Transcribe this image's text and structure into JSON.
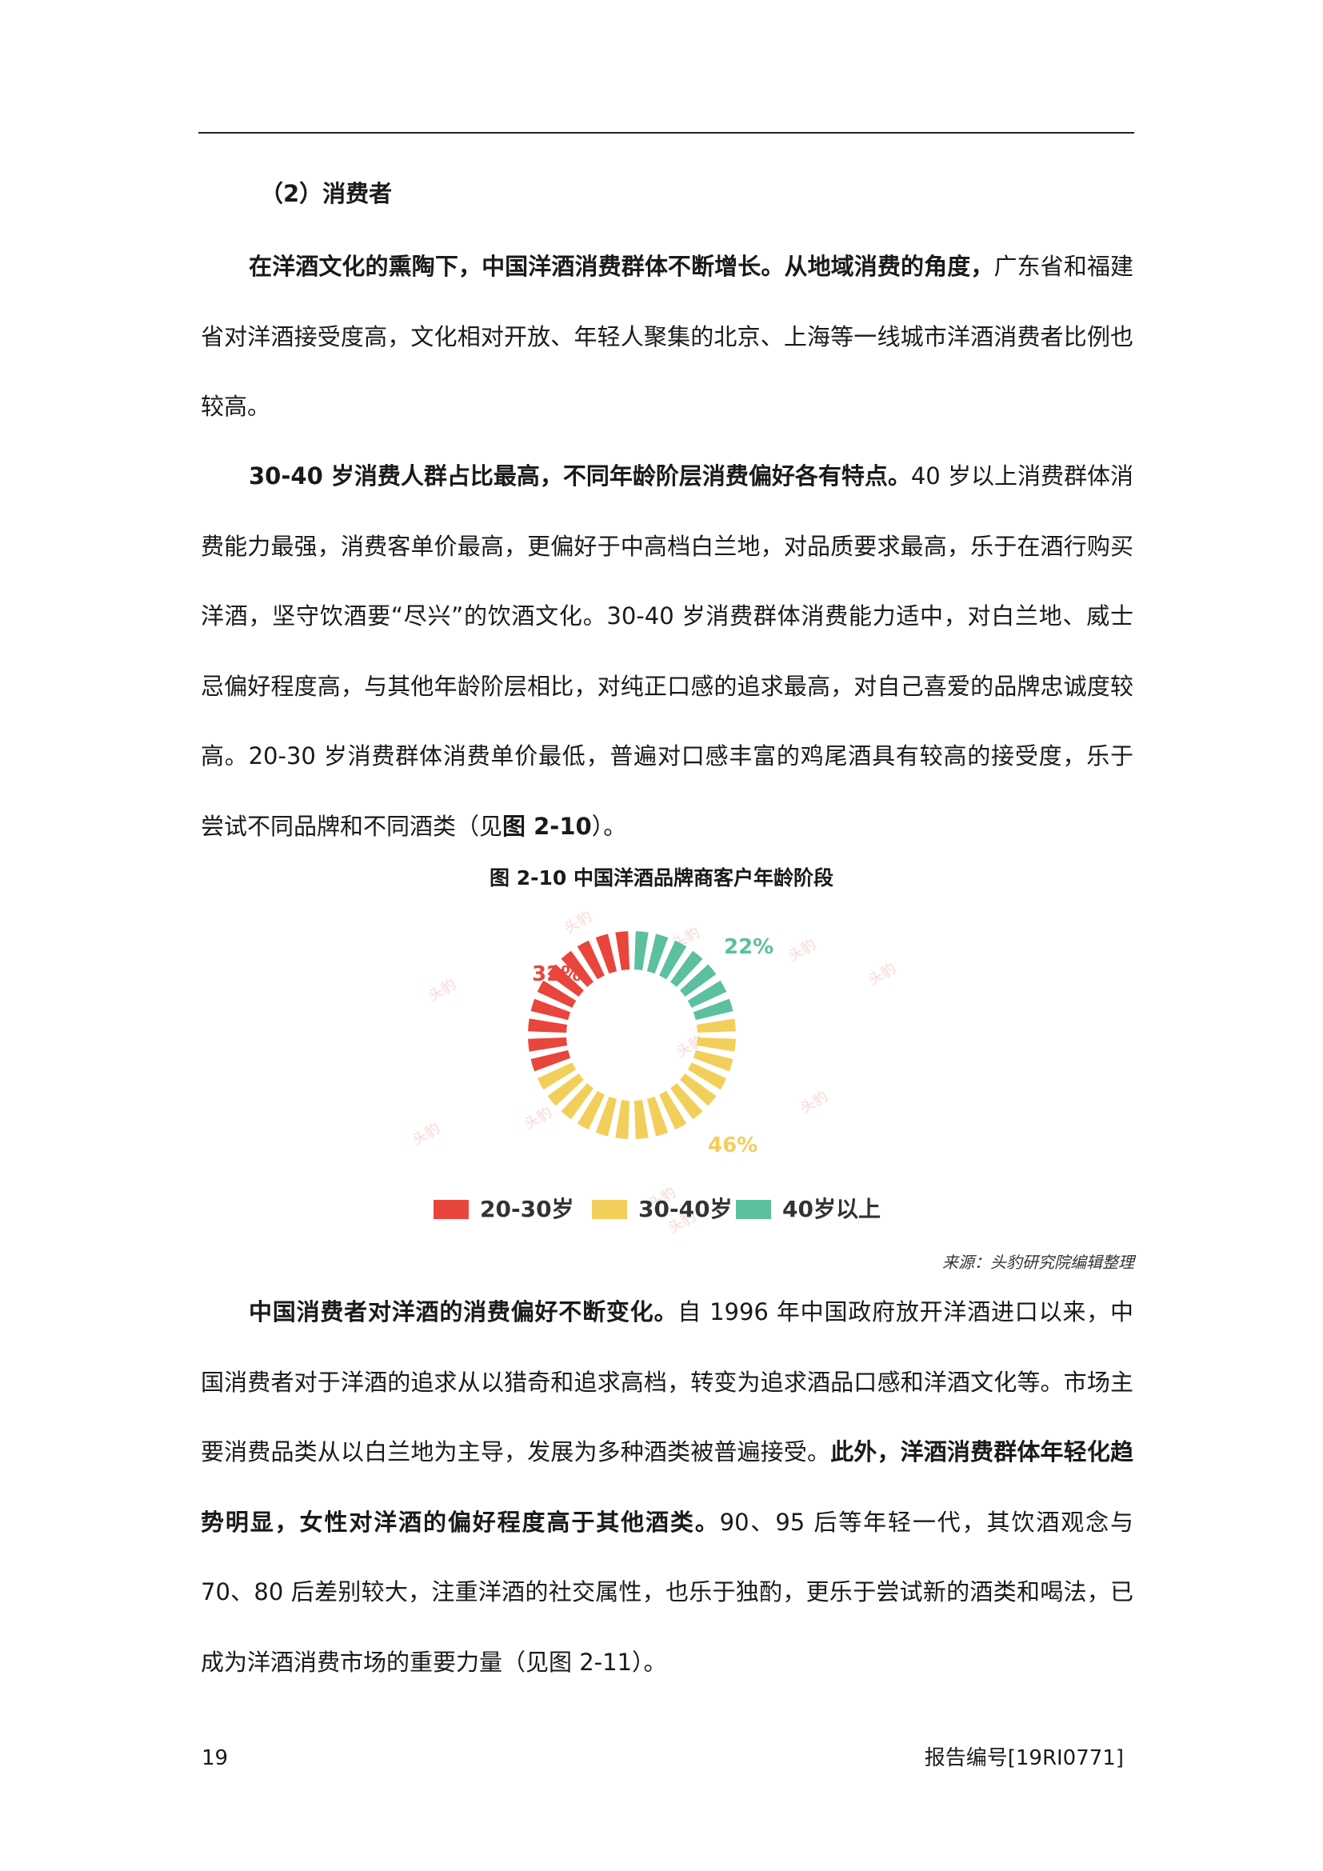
{
  "header": {},
  "section": {
    "heading": "（2）消费者"
  },
  "paragraphs": {
    "p1": [
      {
        "text": "在洋酒文化的熏陶下，中国洋酒消费群体不断增长。从地域消费的角度，",
        "bold": true
      },
      {
        "text": "广东省和福建省对洋酒接受度高，文化相对开放、年轻人聚集的北京、上海等一线城市洋酒消费者比例也较高。",
        "bold": false
      }
    ],
    "p2": [
      {
        "text": "30-40 岁消费人群占比最高，不同年龄阶层消费偏好各有特点。",
        "bold": true
      },
      {
        "text": "40 岁以上消费群体消费能力最强，消费客单价最高，更偏好于中高档白兰地，对品质要求最高，乐于在酒行购买洋酒，坚守饮酒要“尽兴”的饮酒文化。30-40 岁消费群体消费能力适中，对白兰地、威士忌偏好程度高，与其他年龄阶层相比，对纯正口感的追求最高，对自己喜爱的品牌忠诚度较高。20-30 岁消费群体消费单价最低，普遍对口感丰富的鸡尾酒具有较高的接受度，乐于尝试不同品牌和不同酒类（见",
        "bold": false
      },
      {
        "text": "图 2-10",
        "bold": true
      },
      {
        "text": "）。",
        "bold": false
      }
    ],
    "p3": [
      {
        "text": "中国消费者对洋酒的消费偏好不断变化。",
        "bold": true
      },
      {
        "text": "自 1996 年中国政府放开洋酒进口以来，中国消费者对于洋酒的追求从以猎奇和追求高档，转变为追求酒品口感和洋酒文化等。市场主要消费品类从以白兰地为主导，发展为多种酒类被普遍接受。",
        "bold": false
      },
      {
        "text": "此外，洋酒消费群体年轻化趋势明显，女性对洋酒的偏好程度高于其他酒类。",
        "bold": true
      },
      {
        "text": "90、95 后等年轻一代，其饮酒观念与 70、80 后差别较大，注重洋酒的社交属性，也乐于独酌，更乐于尝试新的酒类和喝法，已成为洋酒消费市场的重要力量（见图 2-11）。",
        "bold": false
      }
    ]
  },
  "figure": {
    "title": "图 2-10  中国洋酒品牌商客户年龄阶段",
    "source": "来源：头豹研究院编辑整理",
    "watermark_text": "头豹"
  },
  "chart_data": {
    "type": "pie",
    "style": "segmented-donut",
    "categories": [
      "20-30岁",
      "30-40岁",
      "40岁以上"
    ],
    "values": [
      32,
      46,
      22
    ],
    "value_labels": [
      "32%",
      "46%",
      "22%"
    ],
    "colors": [
      "#E8453C",
      "#F2CF5B",
      "#5BBFA0"
    ],
    "legend_position": "bottom",
    "title": "",
    "xlabel": "",
    "ylabel": ""
  },
  "footer": {
    "page_number": "19",
    "report_number": "报告编号[19RI0771]"
  }
}
